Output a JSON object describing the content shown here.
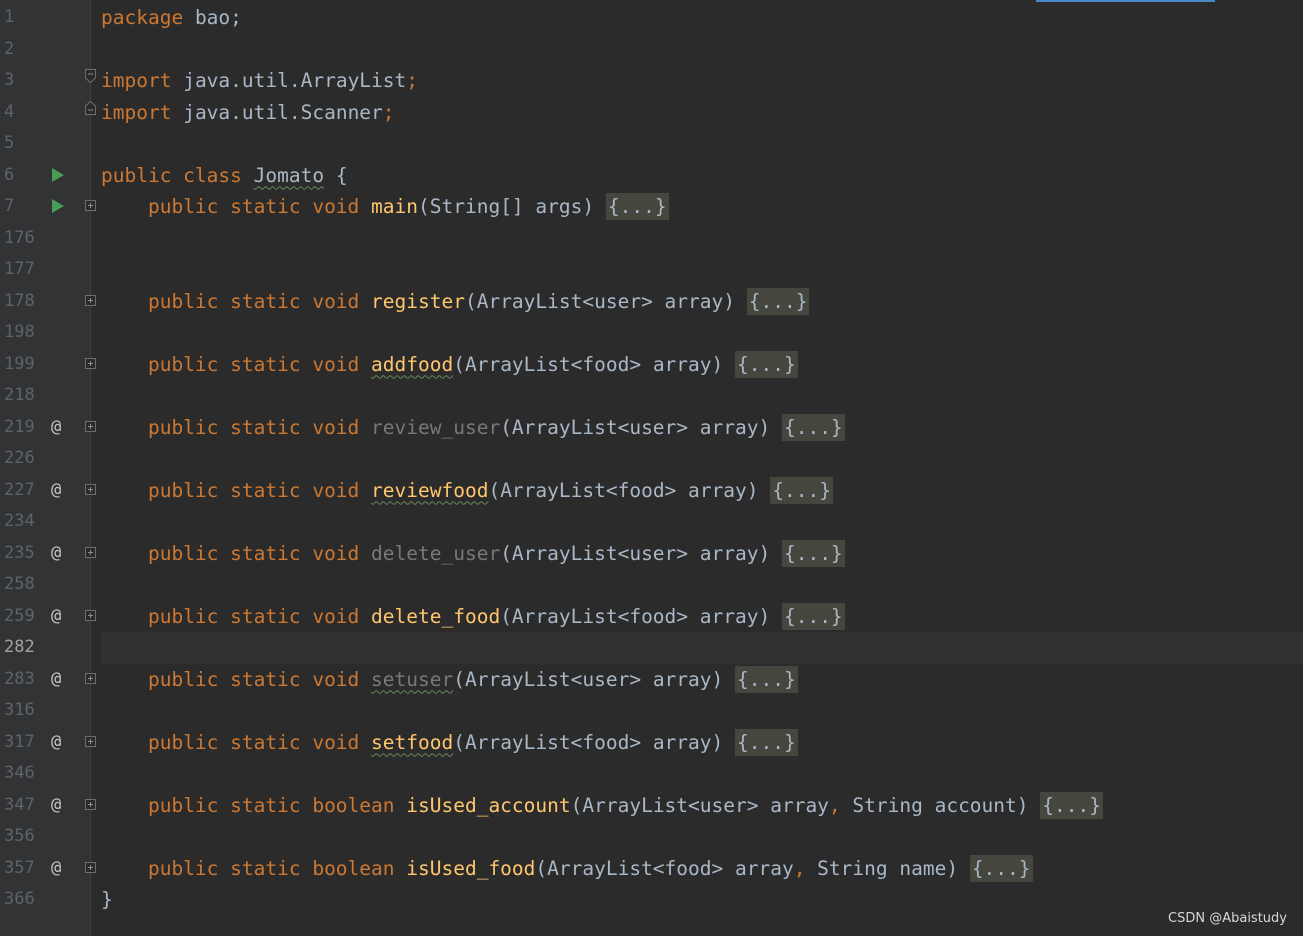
{
  "file": {
    "package_kw": "package",
    "package_name": "bao;",
    "import_kw": "import",
    "imports": [
      "java.util.ArrayList",
      "java.util.Scanner"
    ],
    "class_mods": "public class",
    "class_name": "Jomato",
    "class_open": "{",
    "class_close": "}",
    "collapsed": "{...}"
  },
  "line_numbers": [
    "1",
    "2",
    "3",
    "4",
    "5",
    "6",
    "7",
    "176",
    "177",
    "178",
    "198",
    "199",
    "218",
    "219",
    "226",
    "227",
    "234",
    "235",
    "258",
    "259",
    "282",
    "283",
    "316",
    "317",
    "346",
    "347",
    "356",
    "357",
    "366"
  ],
  "current_line": "282",
  "methods": [
    {
      "mods": "public static void",
      "name": "main",
      "params": "(String[] args)",
      "line": "7",
      "marker": "run"
    },
    {
      "mods": "public static void",
      "name": "register",
      "params": "(ArrayList<user> array)",
      "line": "178",
      "marker": ""
    },
    {
      "mods": "public static void",
      "name": "addfood",
      "params": "(ArrayList<food> array)",
      "line": "199",
      "marker": ""
    },
    {
      "mods": "public static void",
      "name": "review_user",
      "params": "(ArrayList<user> array)",
      "line": "219",
      "marker": "@"
    },
    {
      "mods": "public static void",
      "name": "reviewfood",
      "params": "(ArrayList<food> array)",
      "line": "227",
      "marker": "@"
    },
    {
      "mods": "public static void",
      "name": "delete_user",
      "params": "(ArrayList<user> array)",
      "line": "235",
      "marker": "@"
    },
    {
      "mods": "public static void",
      "name": "delete_food",
      "params": "(ArrayList<food> array)",
      "line": "259",
      "marker": "@"
    },
    {
      "mods": "public static void",
      "name": "setuser",
      "params": "(ArrayList<user> array)",
      "line": "283",
      "marker": "@"
    },
    {
      "mods": "public static void",
      "name": "setfood",
      "params": "(ArrayList<food> array)",
      "line": "317",
      "marker": "@"
    },
    {
      "mods": "public static boolean",
      "name": "isUsed_account",
      "params_a": "(ArrayList<user> array",
      "params_b": " String account)",
      "line": "347",
      "marker": "@"
    },
    {
      "mods": "public static boolean",
      "name": "isUsed_food",
      "params_a": "(ArrayList<food> array",
      "params_b": " String name)",
      "line": "357",
      "marker": "@"
    }
  ],
  "at_symbol": "@",
  "comma": ",",
  "watermark": "CSDN @Abaistudy",
  "colors": {
    "background": "#2b2b2b",
    "gutter": "#313335",
    "keyword": "#cc7832",
    "method": "#ffc66d",
    "text": "#a9b7c6",
    "run_icon": "#499c54"
  }
}
